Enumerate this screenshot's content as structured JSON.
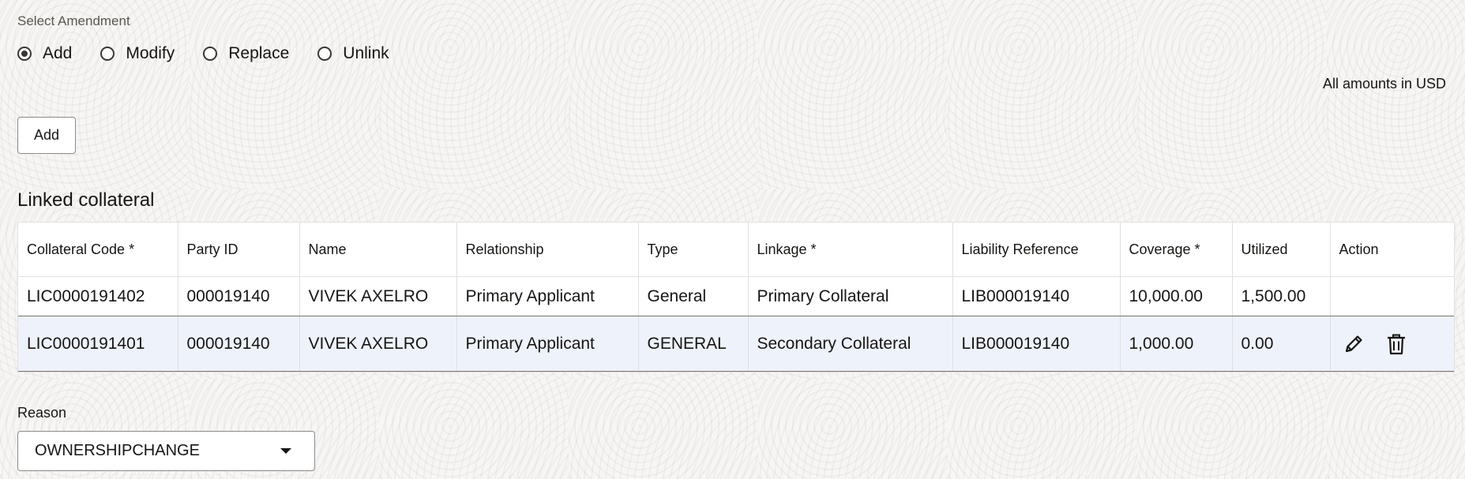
{
  "amendment": {
    "label": "Select Amendment",
    "options": [
      {
        "label": "Add",
        "selected": true
      },
      {
        "label": "Modify",
        "selected": false
      },
      {
        "label": "Replace",
        "selected": false
      },
      {
        "label": "Unlink",
        "selected": false
      }
    ]
  },
  "amounts_note": "All amounts in USD",
  "add_button_label": "Add",
  "linked_collateral": {
    "title": "Linked collateral",
    "columns": [
      "Collateral Code *",
      "Party ID",
      "Name",
      "Relationship",
      "Type",
      "Linkage *",
      "Liability Reference",
      "Coverage *",
      "Utilized",
      "Action"
    ],
    "rows": [
      {
        "collateral_code": "LIC0000191402",
        "party_id": "000019140",
        "name": "VIVEK AXELRO",
        "relationship": "Primary Applicant",
        "type": "General",
        "linkage": "Primary Collateral",
        "liability_reference": "LIB000019140",
        "coverage": "10,000.00",
        "utilized": "1,500.00"
      },
      {
        "collateral_code": "LIC0000191401",
        "party_id": "000019140",
        "name": "VIVEK AXELRO",
        "relationship": "Primary Applicant",
        "type": "GENERAL",
        "linkage": "Secondary Collateral",
        "liability_reference": "LIB000019140",
        "coverage": "1,000.00",
        "utilized": "0.00",
        "actions": [
          "edit-icon",
          "delete-icon"
        ]
      }
    ]
  },
  "reason": {
    "label": "Reason",
    "value": "OWNERSHIPCHANGE"
  },
  "colors": {
    "selected_row": "#eef2fb",
    "text": "#161513"
  }
}
